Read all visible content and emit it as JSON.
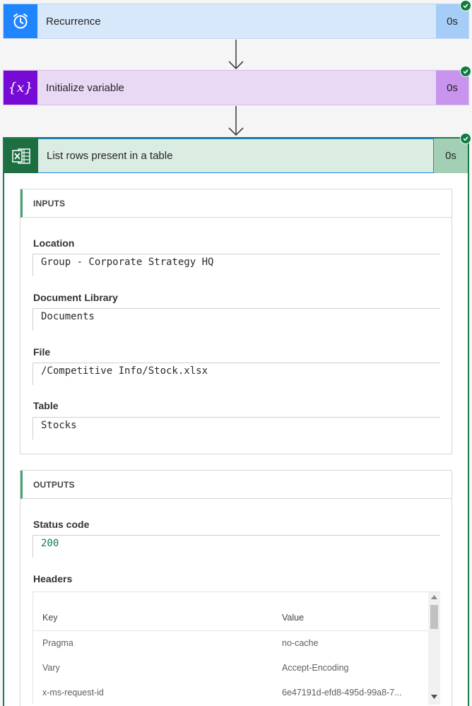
{
  "steps": [
    {
      "title": "Recurrence",
      "duration": "0s",
      "icon": "alarm-clock-icon"
    },
    {
      "title": "Initialize variable",
      "duration": "0s",
      "icon": "variable-icon"
    },
    {
      "title": "List rows present in a table",
      "duration": "0s",
      "icon": "excel-icon"
    }
  ],
  "colors": {
    "recurrence_accent": "#1f85ff",
    "variable_accent": "#770bd6",
    "excel_accent": "#1d6f42",
    "success": "#107c41"
  },
  "inputs": {
    "heading": "INPUTS",
    "location_label": "Location",
    "location_value": "Group - Corporate Strategy HQ",
    "library_label": "Document Library",
    "library_value": "Documents",
    "file_label": "File",
    "file_value": "/Competitive Info/Stock.xlsx",
    "table_label": "Table",
    "table_value": "Stocks"
  },
  "outputs": {
    "heading": "OUTPUTS",
    "status_label": "Status code",
    "status_value": "200",
    "headers_label": "Headers",
    "headers_columns": {
      "key": "Key",
      "value": "Value"
    },
    "headers_rows": [
      {
        "key": "Pragma",
        "value": "no-cache"
      },
      {
        "key": "Vary",
        "value": "Accept-Encoding"
      },
      {
        "key": "x-ms-request-id",
        "value": "6e47191d-efd8-495d-99a8-7..."
      }
    ]
  }
}
